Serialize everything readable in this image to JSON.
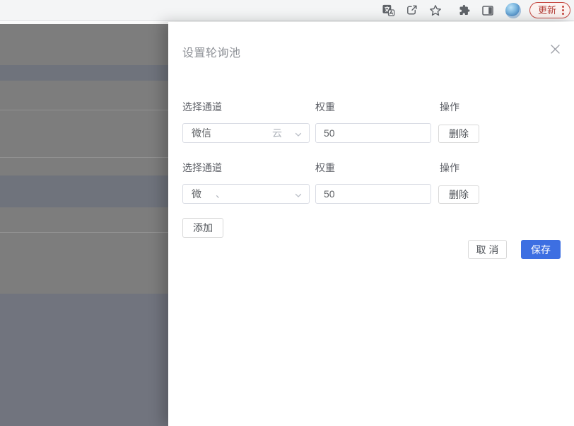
{
  "browser_toolbar": {
    "icons": [
      "translate-icon",
      "share-icon",
      "bookmark-star-icon",
      "extensions-icon",
      "side-panel-icon",
      "profile-avatar"
    ],
    "update_button": {
      "label": "更新",
      "accent_red": "#b5413a"
    }
  },
  "drawer": {
    "title": "设置轮询池",
    "rows": [
      {
        "channel_label": "选择通道",
        "weight_label": "权重",
        "action_label": "操作",
        "channel_value": "微信",
        "channel_residual": "云",
        "weight_value": "50",
        "delete_label": "删除"
      },
      {
        "channel_label": "选择通道",
        "weight_label": "权重",
        "action_label": "操作",
        "channel_value": "微",
        "channel_residual": "、",
        "weight_value": "50",
        "delete_label": "删除"
      }
    ],
    "add_label": "添加",
    "cancel_label": "取 消",
    "save_label": "保存",
    "accent_blue": "#3d6fe2"
  }
}
